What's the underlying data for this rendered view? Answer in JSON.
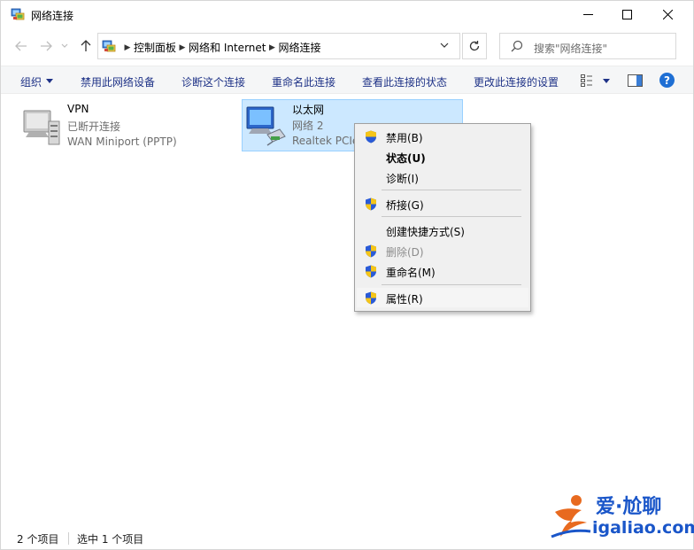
{
  "window": {
    "title": "网络连接"
  },
  "titlebar": {
    "minimize_icon": "minimize-icon",
    "maximize_icon": "maximize-icon",
    "close_icon": "close-icon"
  },
  "nav": {
    "breadcrumbs": [
      "控制面板",
      "网络和 Internet",
      "网络连接"
    ],
    "search_placeholder": "搜索\"网络连接\""
  },
  "toolbar": {
    "organize": "组织",
    "disable_device": "禁用此网络设备",
    "diagnose": "诊断这个连接",
    "rename": "重命名此连接",
    "view_status": "查看此连接的状态",
    "change_settings": "更改此连接的设置",
    "help": "?"
  },
  "connections": [
    {
      "name": "VPN",
      "status": "已断开连接",
      "device": "WAN Miniport (PPTP)"
    },
    {
      "name": "以太网",
      "status": "网络 2",
      "device": "Realtek PCIe"
    }
  ],
  "context_menu": {
    "items": [
      {
        "label": "禁用(B)",
        "shield": true,
        "bold": false,
        "disabled": false
      },
      {
        "label": "状态(U)",
        "shield": false,
        "bold": true,
        "disabled": false
      },
      {
        "label": "诊断(I)",
        "shield": false,
        "bold": false,
        "disabled": false
      },
      {
        "label": "桥接(G)",
        "shield": true,
        "bold": false,
        "disabled": false
      },
      {
        "label": "创建快捷方式(S)",
        "shield": false,
        "bold": false,
        "disabled": false
      },
      {
        "label": "删除(D)",
        "shield": true,
        "bold": false,
        "disabled": true
      },
      {
        "label": "重命名(M)",
        "shield": true,
        "bold": false,
        "disabled": false
      },
      {
        "label": "属性(R)",
        "shield": true,
        "bold": false,
        "disabled": false
      }
    ]
  },
  "statusbar": {
    "count": "2 个项目",
    "selected": "选中 1 个项目"
  },
  "watermark": {
    "line1": "爱·尬聊",
    "line2": "igaliao.com"
  },
  "colors": {
    "accent": "#1e3287",
    "selection_bg": "#cce8ff",
    "selection_border": "#99d1ff",
    "menu_bg": "#f0f0f0",
    "help": "#1f6fd4"
  }
}
